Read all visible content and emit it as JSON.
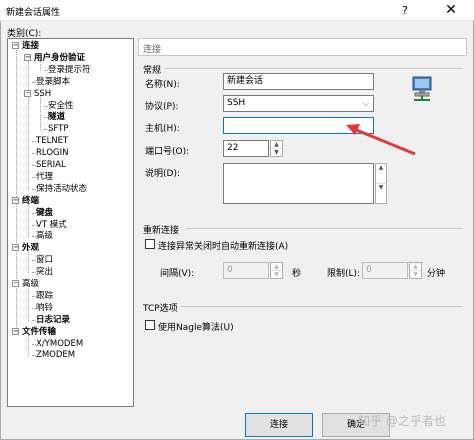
{
  "window": {
    "title": "新建会话属性",
    "help": "?",
    "close": "✕"
  },
  "category_label": "类别(C):",
  "tree": [
    {
      "label": "连接",
      "sign": "−",
      "bold": true
    },
    {
      "label": "用户身份验证",
      "sign": "−",
      "bold": true
    },
    {
      "label": "登录提示符",
      "sign": "",
      "bold": false
    },
    {
      "label": "登录脚本",
      "sign": "",
      "bold": false
    },
    {
      "label": "SSH",
      "sign": "−",
      "bold": false
    },
    {
      "label": "安全性",
      "sign": "",
      "bold": false
    },
    {
      "label": "隧道",
      "sign": "",
      "bold": true
    },
    {
      "label": "SFTP",
      "sign": "",
      "bold": false
    },
    {
      "label": "TELNET",
      "sign": "",
      "bold": false
    },
    {
      "label": "RLOGIN",
      "sign": "",
      "bold": false
    },
    {
      "label": "SERIAL",
      "sign": "",
      "bold": false
    },
    {
      "label": "代理",
      "sign": "",
      "bold": false
    },
    {
      "label": "保持活动状态",
      "sign": "",
      "bold": false
    },
    {
      "label": "终端",
      "sign": "−",
      "bold": true
    },
    {
      "label": "键盘",
      "sign": "",
      "bold": true
    },
    {
      "label": "VT 模式",
      "sign": "",
      "bold": false
    },
    {
      "label": "高级",
      "sign": "",
      "bold": false
    },
    {
      "label": "外观",
      "sign": "−",
      "bold": true
    },
    {
      "label": "窗口",
      "sign": "",
      "bold": false
    },
    {
      "label": "突出",
      "sign": "",
      "bold": false
    },
    {
      "label": "高级",
      "sign": "−",
      "bold": false
    },
    {
      "label": "跟踪",
      "sign": "",
      "bold": false
    },
    {
      "label": "响铃",
      "sign": "",
      "bold": false
    },
    {
      "label": "日志记录",
      "sign": "",
      "bold": true
    },
    {
      "label": "文件传输",
      "sign": "−",
      "bold": true
    },
    {
      "label": "X/YMODEM",
      "sign": "",
      "bold": false
    },
    {
      "label": "ZMODEM",
      "sign": "",
      "bold": false
    }
  ],
  "panel": {
    "header": "连接",
    "general": {
      "title": "常规",
      "name_label": "名称(N):",
      "name_value": "新建会话",
      "protocol_label": "协议(P):",
      "protocol_value": "SSH",
      "host_label": "主机(H):",
      "host_value": "",
      "port_label": "端口号(O):",
      "port_value": "22",
      "desc_label": "说明(D):",
      "desc_value": ""
    },
    "reconnect": {
      "title": "重新连接",
      "checkbox_label": "连接异常关闭时自动重新连接(A)",
      "interval_label": "间隔(V):",
      "interval_value": "0",
      "interval_unit": "秒",
      "limit_label": "限制(L):",
      "limit_value": "0",
      "limit_unit": "分钟"
    },
    "tcp": {
      "title": "TCP选项",
      "nagle_label": "使用Nagle算法(U)"
    }
  },
  "buttons": {
    "connect": "连接",
    "ok": "确定"
  },
  "watermark": "知乎 @之乎者也",
  "colors": {
    "accent": "#0078d7",
    "arrow": "#e53935"
  }
}
